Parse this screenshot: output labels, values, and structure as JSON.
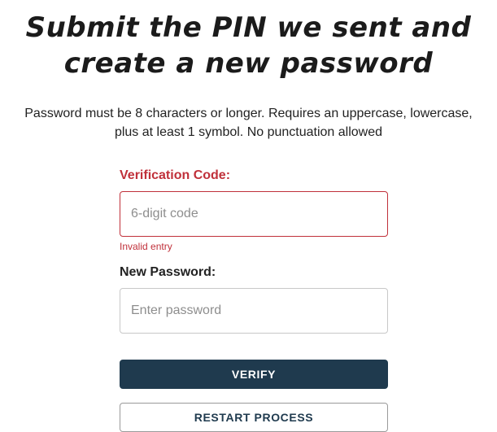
{
  "header": {
    "title_line1": "Submit the PIN we sent and",
    "title_line2": "create a new password"
  },
  "requirements": {
    "line1": "Password must be 8 characters or longer. Requires an uppercase, lowercase,",
    "line2": "plus at least 1 symbol. No punctuation allowed"
  },
  "form": {
    "verification_code": {
      "label": "Verification Code:",
      "placeholder": "6-digit code",
      "value": "",
      "error": "Invalid entry"
    },
    "new_password": {
      "label": "New Password:",
      "placeholder": "Enter password",
      "value": ""
    },
    "verify_label": "VERIFY",
    "restart_label": "RESTART PROCESS"
  },
  "colors": {
    "primary": "#1f3a4e",
    "error": "#c0303a",
    "border": "#c8c8c8"
  }
}
